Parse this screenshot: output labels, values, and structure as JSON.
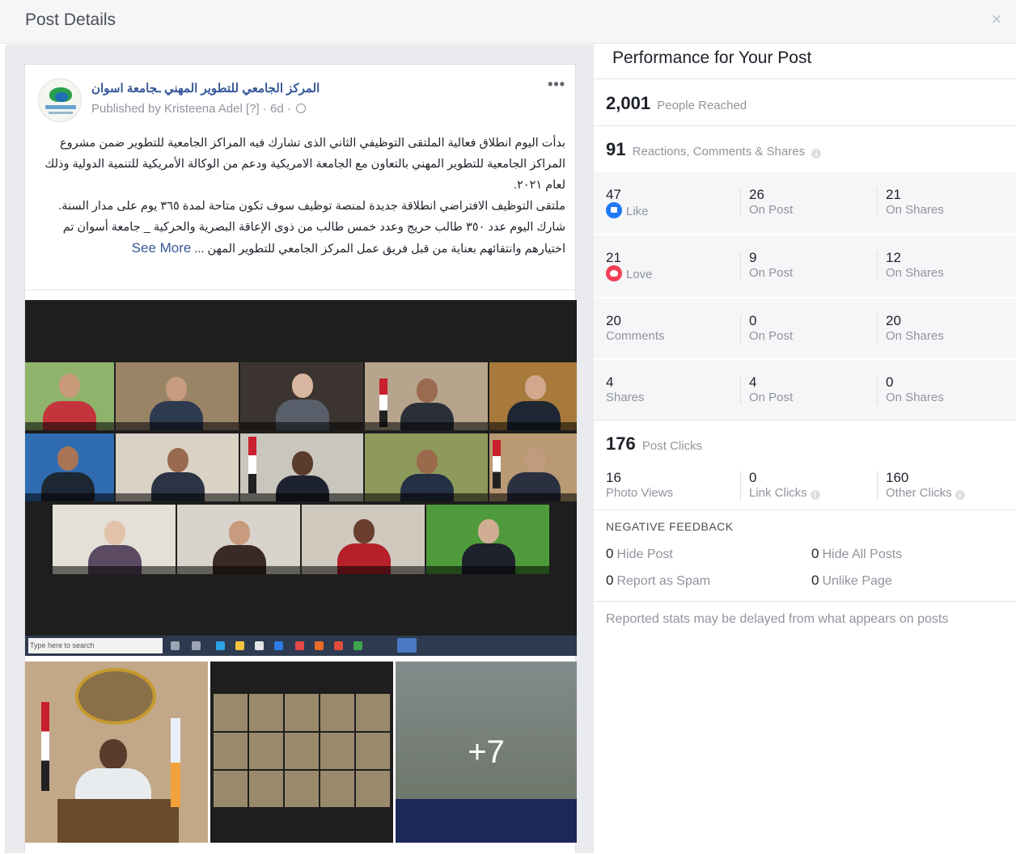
{
  "modal": {
    "title": "Post Details",
    "close_icon": "×"
  },
  "post": {
    "page_name": "المركز الجامعي للتطوير المهني ـجامعة اسوان",
    "published_by": "Published by Kristeena Adel",
    "published_suffix": "[?] · 6d ·",
    "more_icon": "•••",
    "text_lines": [
      "بدأت اليوم انطلاق فعالية الملتقى التوظيفي الثاني الذى تشارك فيه المراكز الجامعية للتطوير ضمن مشروع المراكز الجامعية للتطوير المهني بالتعاون مع الجامعة الامريكية ودعم من الوكالة الأمريكية للتنمية الدولية وذلك لعام ٢٠٢١.",
      "ملتقى التوظيف الافتراضي انطلاقة جديدة لمنصة توظيف سوف تكون متاحة لمدة ٣٦٥ يوم على مدار السنة.",
      "شارك اليوم عدد ٣٥٠ طالب حريج وعدد خمس طالب من ذوى الإعاقة البصرية والحركية _ جامعة أسوان تم اختيارهم وانتقائهم بعناية من قبل فريق عمل المركز الجامعي للتطوير المهن ..."
    ],
    "see_more": "See More",
    "taskbar_search": "Type here to search",
    "more_photos": "+7"
  },
  "performance": {
    "title": "Performance for Your Post",
    "people_reached": {
      "value": "2,001",
      "label": "People Reached"
    },
    "engagement": {
      "value": "91",
      "label": "Reactions, Comments & Shares"
    },
    "reactions": [
      {
        "total": "47",
        "label": "Like",
        "on_post": "26",
        "on_shares": "21",
        "icon": "like-icon"
      },
      {
        "total": "21",
        "label": "Love",
        "on_post": "9",
        "on_shares": "12",
        "icon": "love-icon"
      },
      {
        "total": "20",
        "label": "Comments",
        "on_post": "0",
        "on_shares": "20"
      },
      {
        "total": "4",
        "label": "Shares",
        "on_post": "4",
        "on_shares": "0"
      }
    ],
    "on_post_label": "On Post",
    "on_shares_label": "On Shares",
    "post_clicks": {
      "value": "176",
      "label": "Post Clicks"
    },
    "clicks": [
      {
        "value": "16",
        "label": "Photo Views"
      },
      {
        "value": "0",
        "label": "Link Clicks"
      },
      {
        "value": "160",
        "label": "Other Clicks"
      }
    ],
    "negative_feedback": {
      "title": "NEGATIVE FEEDBACK",
      "items": [
        {
          "value": "0",
          "label": "Hide Post"
        },
        {
          "value": "0",
          "label": "Hide All Posts"
        },
        {
          "value": "0",
          "label": "Report as Spam"
        },
        {
          "value": "0",
          "label": "Unlike Page"
        }
      ]
    },
    "note": "Reported stats may be delayed from what appears on posts"
  },
  "colors": {
    "link": "#365899",
    "like": "#2078f4",
    "love": "#f33e58",
    "muted": "#90949c"
  }
}
